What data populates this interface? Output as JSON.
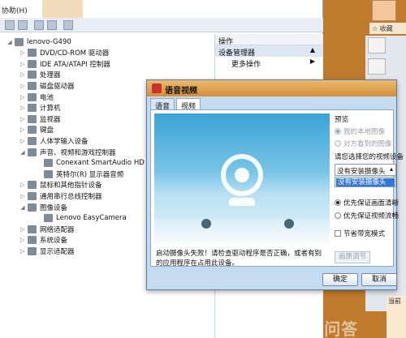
{
  "device_manager": {
    "menu_fragment": "协助(H)",
    "tree": {
      "root": "lenovo-G490",
      "nodes": [
        {
          "label": "DVD/CD-ROM 驱动器",
          "level": 1
        },
        {
          "label": "IDE ATA/ATAPI 控制器",
          "level": 1
        },
        {
          "label": "处理器",
          "level": 1
        },
        {
          "label": "磁盘驱动器",
          "level": 1
        },
        {
          "label": "电池",
          "level": 1
        },
        {
          "label": "计算机",
          "level": 1
        },
        {
          "label": "监视器",
          "level": 1
        },
        {
          "label": "键盘",
          "level": 1
        },
        {
          "label": "人体学输入设备",
          "level": 1
        },
        {
          "label": "声音、视频和游戏控制器",
          "level": 1,
          "expanded": true
        },
        {
          "label": "Conexant SmartAudio HD",
          "level": 2
        },
        {
          "label": "英特尔(R) 显示器音频",
          "level": 2
        },
        {
          "label": "鼠标和其他指针设备",
          "level": 1
        },
        {
          "label": "通用串行总线控制器",
          "level": 1
        },
        {
          "label": "图像设备",
          "level": 1,
          "expanded": true
        },
        {
          "label": "Lenovo EasyCamera",
          "level": 2
        },
        {
          "label": "网络适配器",
          "level": 1
        },
        {
          "label": "系统设备",
          "level": 1
        },
        {
          "label": "显示适配器",
          "level": 1
        }
      ]
    },
    "actions": {
      "header": "操作",
      "device_manager": "设备管理器",
      "more_actions": "更多操作"
    }
  },
  "qq_panel": {
    "collect_label": "收藏",
    "bottom_label": "当前"
  },
  "dialog": {
    "title": "语音视频",
    "tabs": [
      {
        "label": "语音",
        "active": false
      },
      {
        "label": "视频",
        "active": true
      }
    ],
    "status_message": "启动摄像头失败！请检查驱动程序是否正确，或者有别的应用程序在占用此设备。",
    "preview_section_label": "预览",
    "preview_options": [
      {
        "label": "我的本地图像",
        "checked": true,
        "disabled": true
      },
      {
        "label": "对方看到的图像",
        "checked": false,
        "disabled": true
      }
    ],
    "select_device_label": "请您选择您的视频设备",
    "camera_select_value": "没有安装摄像头",
    "camera_dropdown_option": "没有安装摄像头",
    "quality_options": [
      {
        "label": "优先保证画面清晰",
        "checked": true
      },
      {
        "label": "优先保证视频流畅",
        "checked": false
      }
    ],
    "bandwidth_checkbox_label": "节省带宽模式",
    "effects_button": "画质调节",
    "ok_button": "确定",
    "cancel_button": "取消"
  },
  "watermark": "ZOL问答",
  "colors": {
    "dialog_titlebar": "#d9984a",
    "dropdown_highlight": "#3476d6",
    "qq_panel_bg": "#c07a2e"
  }
}
